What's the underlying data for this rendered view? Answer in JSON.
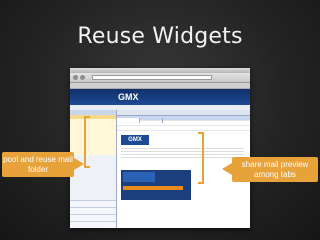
{
  "slide": {
    "title": "Reuse Widgets",
    "callout_left": "pool and reuse mail folder",
    "callout_right": "share mail preview among tabs"
  },
  "screenshot": {
    "app_logo": "GMX",
    "preview_logo": "GMX",
    "accent_color": "#e8a23a",
    "header_color": "#1c4a94"
  }
}
